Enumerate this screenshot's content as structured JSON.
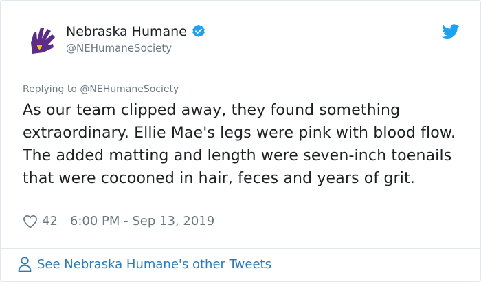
{
  "author": {
    "display_name": "Nebraska Humane",
    "handle": "@NEHumaneSociety",
    "avatar_icon": "nebraska-humane-logo",
    "verified": true
  },
  "reply": {
    "prefix": "Replying to",
    "mention": "@NEHumaneSociety"
  },
  "tweet": {
    "text": "As our team clipped away, they found something extraordinary. Ellie Mae's legs were pink with blood flow. The added matting and length were seven-inch toenails that were cocooned in hair, feces and years of grit."
  },
  "meta": {
    "like_count": "42",
    "timestamp": "6:00 PM - Sep 13, 2019"
  },
  "footer": {
    "link_text": "See Nebraska Humane's other Tweets"
  },
  "colors": {
    "brand_purple": "#5b2d86",
    "brand_yellow": "#f5c518",
    "twitter_blue": "#1da1f2",
    "link_blue": "#2b7bb9",
    "text": "#1c2022",
    "muted": "#697882"
  }
}
